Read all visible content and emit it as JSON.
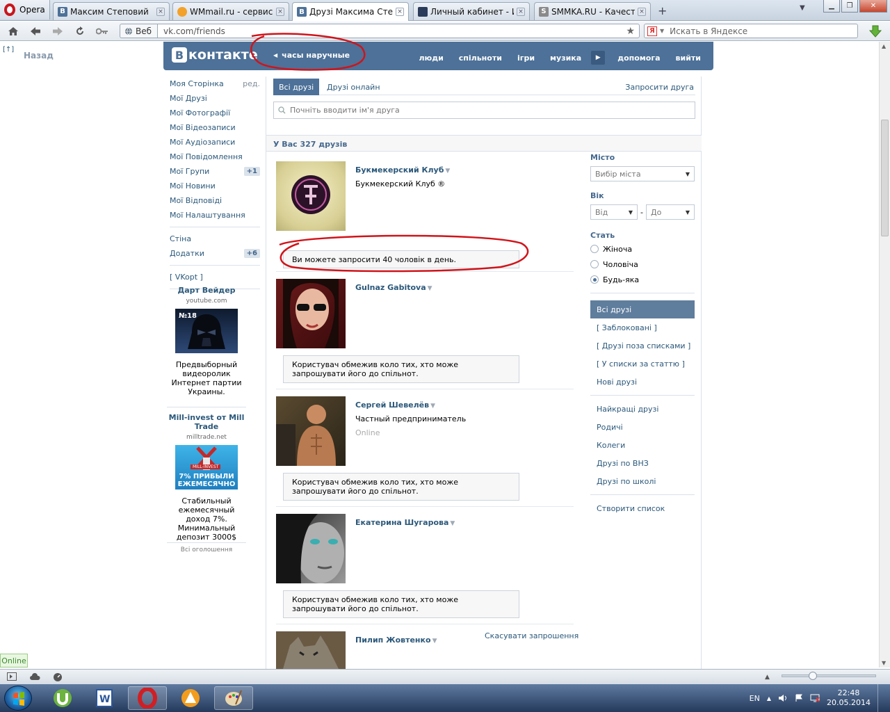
{
  "browser": {
    "app_name": "Opera",
    "tabs": [
      {
        "label": "Максим Степовий",
        "icon": "vk-icon"
      },
      {
        "label": "WMmail.ru - сервис п...",
        "icon": "wmmail-icon"
      },
      {
        "label": "Друзі Максима Степо...",
        "icon": "vk-icon",
        "active": true
      },
      {
        "label": "Личный кабинет - Ис...",
        "icon": "cabinet-icon"
      },
      {
        "label": "SMMKA.RU - Качестве...",
        "icon": "smmka-icon"
      }
    ],
    "web_badge": "Веб",
    "url": "vk.com/friends",
    "search_placeholder": "Искать в Яндексе"
  },
  "nav": {
    "back_top": "[↑]",
    "back": "Назад"
  },
  "vk": {
    "logo_b": "В",
    "logo_text": "контакте",
    "search_query": "часы наручные",
    "menu": [
      "люди",
      "спільноти",
      "ігри",
      "музика",
      "допомога",
      "вийти"
    ]
  },
  "sidebar": {
    "items": [
      {
        "label": "Моя Сторінка",
        "extra": "ред."
      },
      {
        "label": "Мої Друзі"
      },
      {
        "label": "Мої Фотографії"
      },
      {
        "label": "Мої Відеозаписи"
      },
      {
        "label": "Мої Аудіозаписи"
      },
      {
        "label": "Мої Повідомлення"
      },
      {
        "label": "Мої Групи",
        "count": "+1"
      },
      {
        "label": "Мої Новини"
      },
      {
        "label": "Мої Відповіді"
      },
      {
        "label": "Мої Налаштування"
      }
    ],
    "items2": [
      {
        "label": "Стіна"
      },
      {
        "label": "Додатки",
        "count": "+6"
      }
    ],
    "vkopt": "[ VKopt ]",
    "ads": [
      {
        "title": "Дарт Вейдер",
        "domain": "youtube.com",
        "pic_label": "№18",
        "desc": "Предвыборный видеоролик Интернет партии Украины."
      },
      {
        "title": "Mill-invest от Mill Trade",
        "domain": "milltrade.net",
        "pic_label": "MILL-INVEST",
        "pic_text": "7% ПРИБЫЛИ ЕЖЕМЕСЯЧНО",
        "desc": "Стабильный ежемесячный доход 7%. Минимальный депозит 3000$"
      }
    ],
    "all_ads": "Всі оголошення"
  },
  "friends": {
    "tabs": {
      "all": "Всі друзі",
      "online": "Друзі онлайн",
      "invite": "Запросити друга"
    },
    "search_placeholder": "Почніть вводити ім'я друга",
    "count": "У Вас 327 друзів",
    "list": [
      {
        "name": "Букмекерский Клуб",
        "sub": "Букмекерский Клуб ®",
        "status": "",
        "message": "Ви можете запросити 40 чоловік в день."
      },
      {
        "name": "Gulnaz Gabitova",
        "sub": "",
        "status": "",
        "message": "Користувач обмежив коло тих, хто може запрошувати його до спільнот."
      },
      {
        "name": "Сергей Шевелёв",
        "sub": "Частный предприниматель",
        "status": "Online",
        "message": "Користувач обмежив коло тих, хто може запрошувати його до спільнот."
      },
      {
        "name": "Екатерина Шугарова",
        "sub": "",
        "status": "",
        "message": "Користувач обмежив коло тих, хто може запрошувати його до спільнот."
      },
      {
        "name": "Пилип Жовтенко",
        "sub": "",
        "status": "",
        "message": ""
      }
    ],
    "cancel_invite": "Скасувати запрошення"
  },
  "filters": {
    "city_label": "Місто",
    "city_value": "Вибір міста",
    "age_label": "Вік",
    "age_from": "Від",
    "age_dash": "-",
    "age_to": "До",
    "sex_label": "Стать",
    "sex_options": [
      "Жіноча",
      "Чоловіча",
      "Будь-яка"
    ],
    "sex_selected": 2,
    "lists_a": [
      "Всі друзі",
      "[ Заблоковані ]",
      "[ Друзі поза списками ]",
      "[ У списки за статтю ]",
      "Нові друзі"
    ],
    "lists_b": [
      "Найкращі друзі",
      "Родичі",
      "Колеги",
      "Друзі по ВНЗ",
      "Друзі по школі"
    ],
    "create_list": "Створити список"
  },
  "status": {
    "online": "Online"
  },
  "taskbar": {
    "lang": "EN",
    "time": "22:48",
    "date": "20.05.2014"
  },
  "colors": {
    "vk_blue": "#4D7198",
    "link": "#2B587A",
    "annotation": "#d0141a"
  }
}
